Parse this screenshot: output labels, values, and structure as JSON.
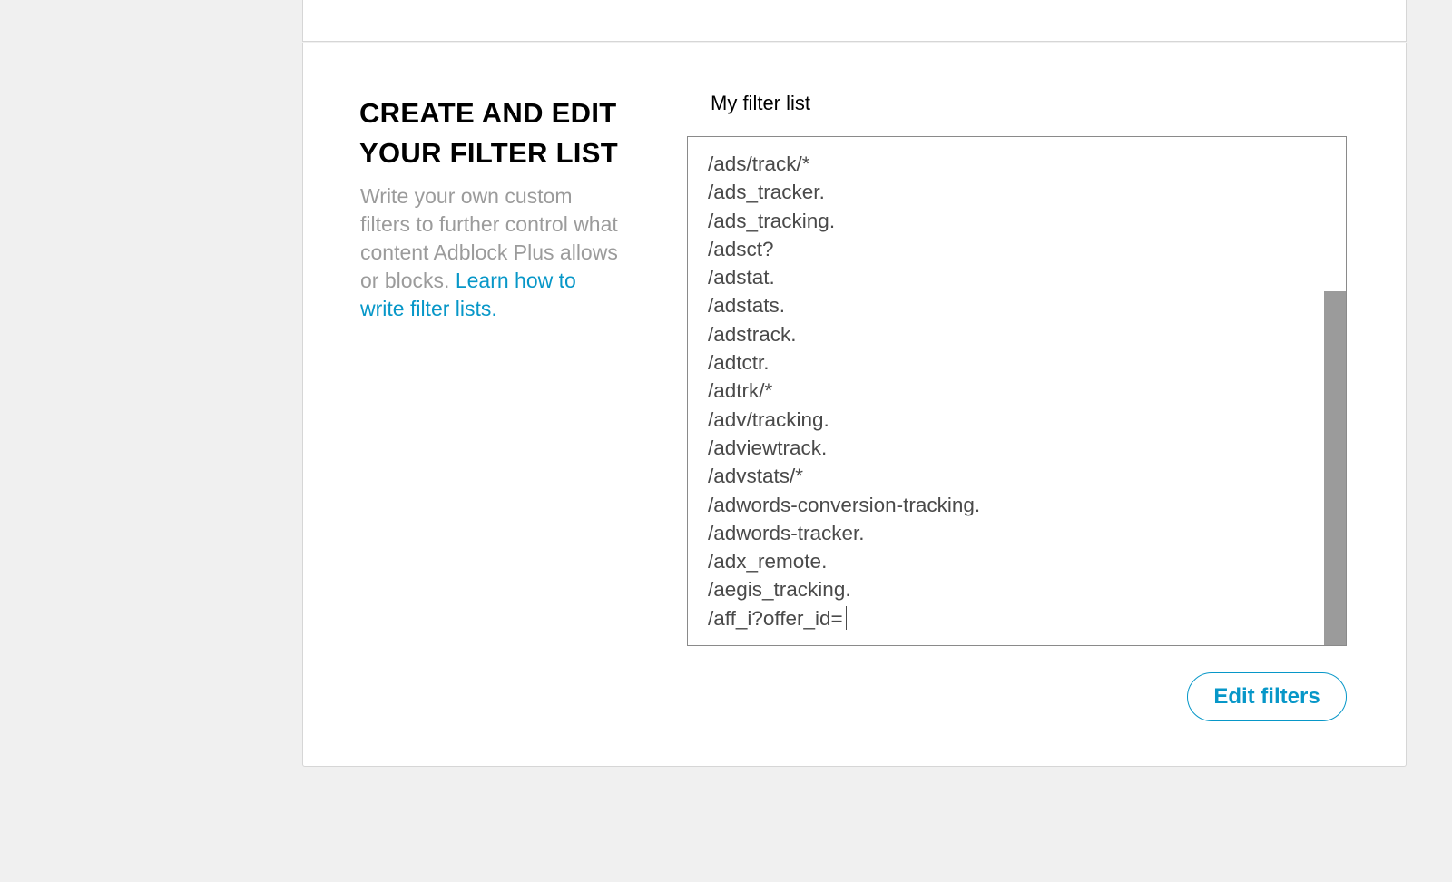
{
  "section": {
    "title": "CREATE AND EDIT YOUR FILTER LIST",
    "description": "Write your own custom filters  to further control what content Adblock Plus allows or blocks.",
    "learn_link": "Learn how to write filter lists."
  },
  "filter_list": {
    "label": "My filter list",
    "lines": [
      "/ads/track/*",
      "/ads_tracker.",
      "/ads_tracking.",
      "/adsct?",
      "/adstat.",
      "/adstats.",
      "/adstrack.",
      "/adtctr.",
      "/adtrk/*",
      "/adv/tracking.",
      "/adviewtrack.",
      "/advstats/*",
      "/adwords-conversion-tracking.",
      "/adwords-tracker.",
      "/adx_remote.",
      "/aegis_tracking.",
      "/aff_i?offer_id="
    ]
  },
  "actions": {
    "edit_label": "Edit filters"
  },
  "colors": {
    "accent": "#0797c8",
    "muted_text": "#9b9b9b",
    "background": "#f0f0f0"
  }
}
